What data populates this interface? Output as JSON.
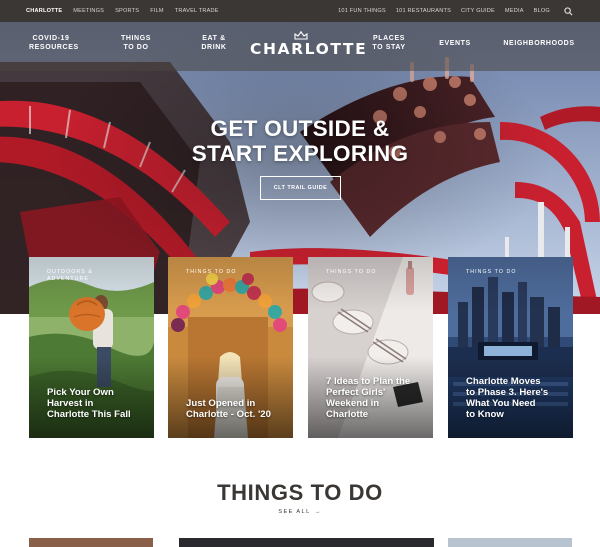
{
  "utility_bar": {
    "left_links": [
      {
        "label": "CHARLOTTE",
        "active": true
      },
      {
        "label": "MEETINGS",
        "active": false
      },
      {
        "label": "SPORTS",
        "active": false
      },
      {
        "label": "FILM",
        "active": false
      },
      {
        "label": "TRAVEL TRADE",
        "active": false
      }
    ],
    "right_links": [
      "101 FUN THINGS",
      "101 RESTAURANTS",
      "CITY GUIDE",
      "MEDIA",
      "BLOG"
    ],
    "search_icon": "search-icon"
  },
  "main_nav": {
    "items": [
      {
        "label": "COVID-19\nRESOURCES"
      },
      {
        "label": "THINGS\nTO DO"
      },
      {
        "label": "EAT &\nDRINK"
      },
      {
        "label": "PLACES\nTO STAY"
      },
      {
        "label": "EVENTS"
      },
      {
        "label": "NEIGHBORHOODS"
      }
    ],
    "logo_text": "CHARLOTTE",
    "logo_icon": "crown-icon"
  },
  "hero": {
    "title_line1": "GET OUTSIDE &",
    "title_line2": "START EXPLORING",
    "cta_label": "CLT TRAIL GUIDE"
  },
  "cards": [
    {
      "category": "OUTDOORS &\nADVENTURE",
      "title": "Pick Your Own\nHarvest in\nCharlotte This Fall"
    },
    {
      "category": "THINGS TO DO",
      "title": "Just Opened in\nCharlotte - Oct. '20"
    },
    {
      "category": "THINGS TO DO",
      "title": "7 Ideas to Plan the\nPerfect Girls'\nWeekend in\nCharlotte"
    },
    {
      "category": "THINGS TO DO",
      "title": "Charlotte Moves\nto Phase 3. Here's\nWhat You Need\nto Know"
    }
  ],
  "things_to_do": {
    "heading": "THINGS TO DO",
    "see_all_label": "SEE ALL",
    "see_all_arrow": "→"
  },
  "colors": {
    "utility_bar_bg": "#3a3734",
    "heading_text": "#3a3734",
    "coaster_red": "#c8202f"
  }
}
